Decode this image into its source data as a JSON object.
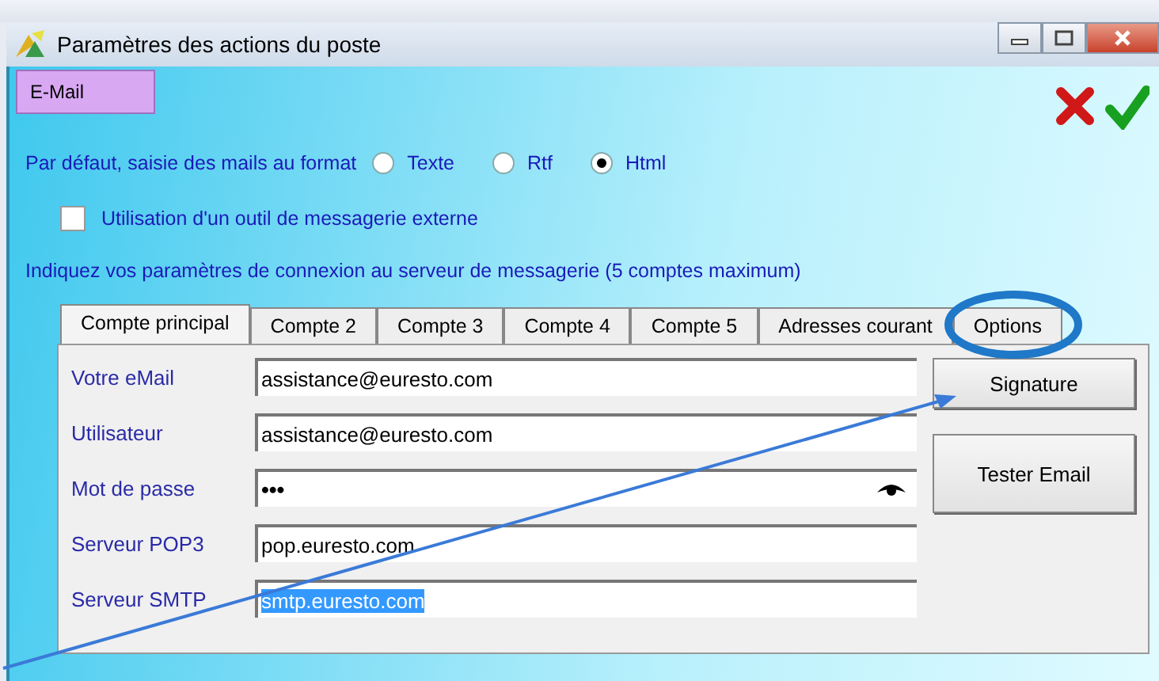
{
  "window": {
    "title": "Paramètres des actions du poste"
  },
  "section_tabs": [
    {
      "label": "E-Mail",
      "selected": true
    }
  ],
  "format": {
    "label": "Par défaut, saisie des mails au format",
    "options": [
      {
        "label": "Texte",
        "selected": false
      },
      {
        "label": "Rtf",
        "selected": false
      },
      {
        "label": "Html",
        "selected": true
      }
    ]
  },
  "external_tool": {
    "label": "Utilisation d'un outil de messagerie externe",
    "checked": false
  },
  "info": "Indiquez vos paramètres de connexion au serveur de messagerie (5 comptes maximum)",
  "account_tabs": [
    {
      "label": "Compte principal",
      "selected": true
    },
    {
      "label": "Compte 2",
      "selected": false
    },
    {
      "label": "Compte 3",
      "selected": false
    },
    {
      "label": "Compte 4",
      "selected": false
    },
    {
      "label": "Compte 5",
      "selected": false
    },
    {
      "label": "Adresses courant",
      "selected": false
    },
    {
      "label": "Options",
      "selected": false
    }
  ],
  "fields": [
    {
      "label": "Votre eMail",
      "value": "assistance@euresto.com",
      "kind": "text",
      "highlighted": false
    },
    {
      "label": "Utilisateur",
      "value": "assistance@euresto.com",
      "kind": "text",
      "highlighted": false
    },
    {
      "label": "Mot de passe",
      "value": "•••",
      "kind": "password",
      "highlighted": false
    },
    {
      "label": "Serveur POP3",
      "value": "pop.euresto.com",
      "kind": "text",
      "highlighted": false
    },
    {
      "label": "Serveur SMTP",
      "value": "smtp.euresto.com",
      "kind": "text",
      "highlighted": true
    }
  ],
  "buttons": [
    "Signature",
    "Tester Email"
  ]
}
